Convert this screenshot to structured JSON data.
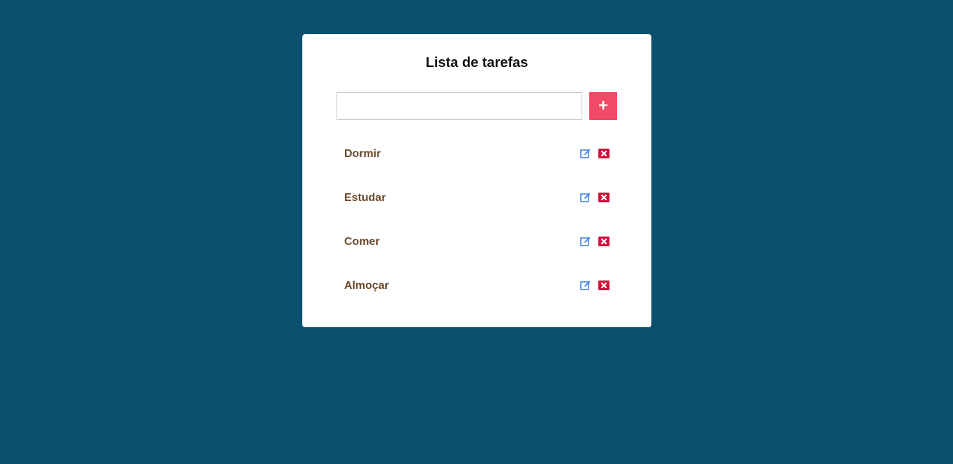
{
  "app": {
    "title": "Lista de tarefas"
  },
  "form": {
    "input_value": "",
    "input_placeholder": "",
    "add_button_label": "+"
  },
  "tasks": [
    {
      "label": "Dormir"
    },
    {
      "label": "Estudar"
    },
    {
      "label": "Comer"
    },
    {
      "label": "Almoçar"
    }
  ],
  "icons": {
    "edit": "edit-icon",
    "delete": "delete-icon"
  },
  "colors": {
    "background": "#0a4f6e",
    "card": "#ffffff",
    "accent": "#f04a66",
    "task_text": "#6b4a2c",
    "edit_icon": "#4a86e8",
    "delete_icon": "#d0103a"
  }
}
